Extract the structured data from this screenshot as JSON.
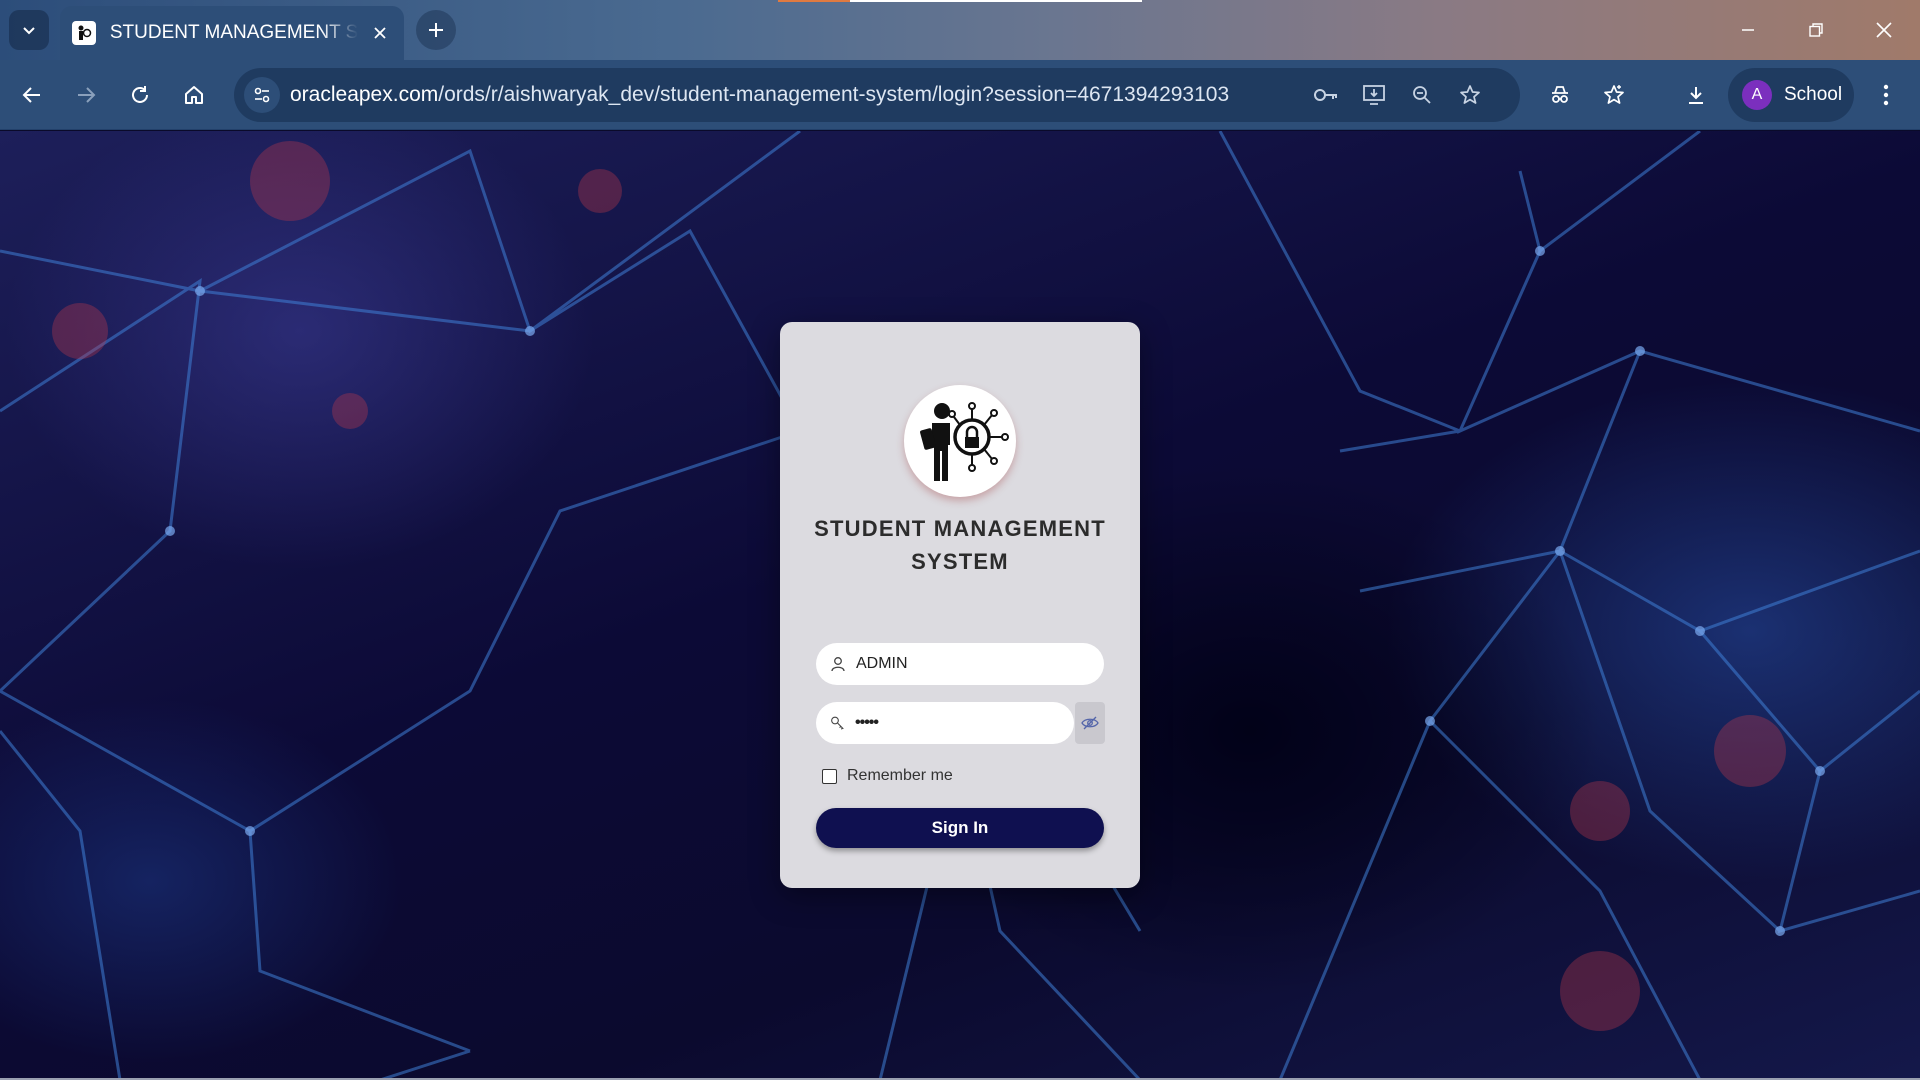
{
  "browser": {
    "tab_title": "STUDENT MANAGEMENT SYSTEM",
    "url_domain": "oracleapex.com",
    "url_path": "/ords/r/aishwaryak_dev/student-management-system/login?session=4671394293103",
    "profile_initial": "A",
    "profile_name": "School"
  },
  "login": {
    "title": "STUDENT MANAGEMENT SYSTEM",
    "username_value": "ADMIN",
    "password_value": "•••••",
    "remember_label": "Remember me",
    "remember_checked": false,
    "signin_label": "Sign In"
  },
  "colors": {
    "chrome": "#2d4e78",
    "button": "#0f1050",
    "card": "#dcdbe0",
    "avatar": "#7b2fbe"
  }
}
